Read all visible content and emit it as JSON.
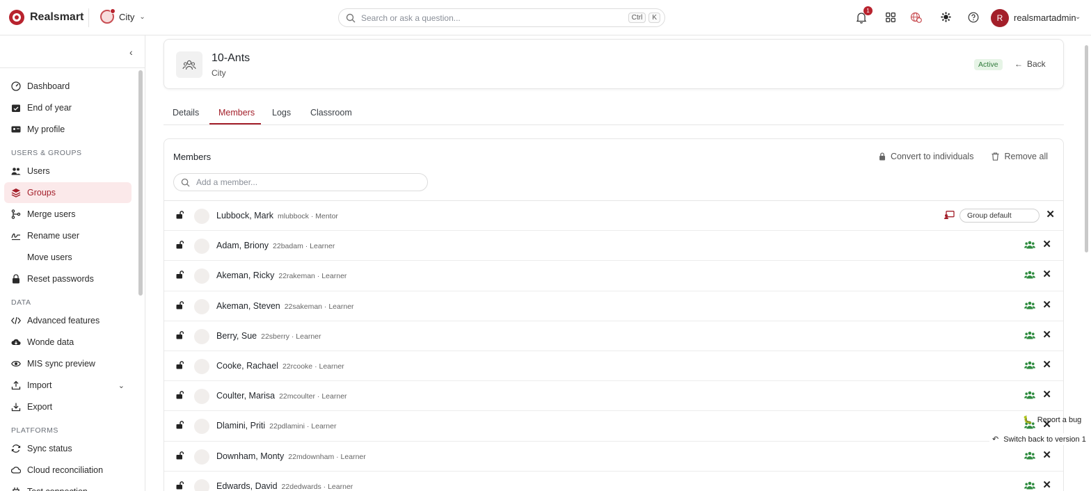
{
  "app": {
    "name": "Realsmart",
    "tenant": "City"
  },
  "search": {
    "placeholder": "Search or ask a question...",
    "kbd1": "Ctrl",
    "kbd2": "K"
  },
  "header": {
    "notification_count": "1",
    "avatar_initial": "R",
    "username": "realsmartadmin"
  },
  "sidebar": {
    "items_top": [
      {
        "label": "Dashboard",
        "icon": "dashboard-icon"
      },
      {
        "label": "End of year",
        "icon": "calendar-check-icon"
      },
      {
        "label": "My profile",
        "icon": "id-card-icon"
      }
    ],
    "section_users": "USERS & GROUPS",
    "items_users": [
      {
        "label": "Users",
        "icon": "users-icon"
      },
      {
        "label": "Groups",
        "icon": "layers-icon",
        "active": true
      },
      {
        "label": "Merge users",
        "icon": "merge-icon"
      },
      {
        "label": "Rename user",
        "icon": "signature-icon"
      },
      {
        "label": "Move users",
        "icon": ""
      },
      {
        "label": "Reset passwords",
        "icon": "lock-icon"
      }
    ],
    "section_data": "DATA",
    "items_data": [
      {
        "label": "Advanced features",
        "icon": "code-icon"
      },
      {
        "label": "Wonde data",
        "icon": "cloud-download-icon"
      },
      {
        "label": "MIS sync preview",
        "icon": "eye-icon"
      },
      {
        "label": "Import",
        "icon": "upload-icon"
      },
      {
        "label": "Export",
        "icon": "download-icon"
      }
    ],
    "section_platforms": "PLATFORMS",
    "items_platforms": [
      {
        "label": "Sync status",
        "icon": "sync-icon"
      },
      {
        "label": "Cloud reconciliation",
        "icon": "cloud-icon"
      },
      {
        "label": "Test connection",
        "icon": "plug-icon"
      }
    ]
  },
  "group": {
    "name": "10-Ants",
    "subtitle": "City",
    "status": "Active",
    "back_label": "Back"
  },
  "tabs": [
    "Details",
    "Members",
    "Logs",
    "Classroom"
  ],
  "members": {
    "title": "Members",
    "convert_label": "Convert to individuals",
    "remove_all_label": "Remove all",
    "add_placeholder": "Add a member...",
    "group_default_label": "Group default",
    "rows": [
      {
        "name": "Lubbock, Mark",
        "meta": "mlubbock · Mentor"
      },
      {
        "name": "Adam, Briony",
        "meta": "22badam · Learner"
      },
      {
        "name": "Akeman, Ricky",
        "meta": "22rakeman · Learner"
      },
      {
        "name": "Akeman, Steven",
        "meta": "22sakeman · Learner"
      },
      {
        "name": "Berry, Sue",
        "meta": "22sberry · Learner"
      },
      {
        "name": "Cooke, Rachael",
        "meta": "22rcooke · Learner"
      },
      {
        "name": "Coulter, Marisa",
        "meta": "22mcoulter · Learner"
      },
      {
        "name": "Dlamini, Priti",
        "meta": "22pdlamini · Learner"
      },
      {
        "name": "Downham, Monty",
        "meta": "22mdownham · Learner"
      },
      {
        "name": "Edwards, David",
        "meta": "22dedwards · Learner"
      }
    ]
  },
  "floating": {
    "report_bug": "Report a bug",
    "switch_back": "Switch back to version 1"
  },
  "colors": {
    "accent": "#a31f2a",
    "group_icon": "#2e8b3f",
    "active_pill_bg": "#e6f4e6"
  }
}
